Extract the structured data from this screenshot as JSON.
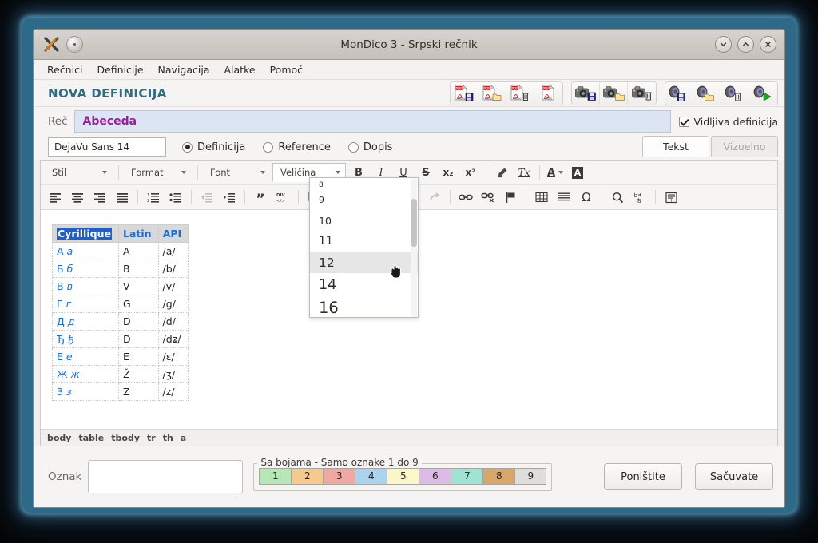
{
  "window": {
    "title": "MonDico 3 - Srpski rečnik",
    "app_icon": "scissors-x-icon",
    "menu_dot_icon": "window-menu-icon",
    "buttons": {
      "minimize": "chevron-down-icon",
      "maximize": "chevron-up-icon",
      "close": "close-icon"
    }
  },
  "menubar": {
    "items": [
      {
        "label": "Rečnici"
      },
      {
        "label": "Definicije"
      },
      {
        "label": "Navigacija"
      },
      {
        "label": "Alatke"
      },
      {
        "label": "Pomoć"
      }
    ]
  },
  "header": {
    "page_title": "NOVA DEFINICIJA",
    "icon_groups": [
      {
        "name": "pdf-group",
        "buttons": [
          {
            "icon": "pdf-save-icon",
            "badge": "floppy"
          },
          {
            "icon": "pdf-open-icon",
            "badge": "folder"
          },
          {
            "icon": "pdf-delete-icon",
            "badge": "trash"
          },
          {
            "icon": "pdf-icon",
            "badge": "none"
          }
        ]
      },
      {
        "name": "photo-group",
        "buttons": [
          {
            "icon": "camera-save-icon",
            "badge": "floppy"
          },
          {
            "icon": "camera-open-icon",
            "badge": "folder"
          },
          {
            "icon": "camera-delete-icon",
            "badge": "trash"
          }
        ]
      },
      {
        "name": "sound-group",
        "buttons": [
          {
            "icon": "sound-save-icon",
            "badge": "floppy"
          },
          {
            "icon": "sound-open-icon",
            "badge": "folder"
          },
          {
            "icon": "sound-delete-icon",
            "badge": "trash"
          },
          {
            "icon": "sound-play-icon",
            "badge": "play"
          }
        ]
      }
    ]
  },
  "word_row": {
    "label": "Reč",
    "value": "Abeceda",
    "visible_definition": {
      "label": "Vidljiva definicija",
      "checked": true
    }
  },
  "font_row": {
    "font_value": "DejaVu Sans 14",
    "radios": [
      {
        "label": "Definicija",
        "selected": true
      },
      {
        "label": "Reference",
        "selected": false
      },
      {
        "label": "Dopis",
        "selected": false
      }
    ],
    "view_tabs": [
      {
        "label": "Tekst",
        "state": "active"
      },
      {
        "label": "Vizuelno",
        "state": "disabled"
      }
    ]
  },
  "editor": {
    "toolbar_row1": {
      "combos": [
        {
          "label": "Stil",
          "open": false
        },
        {
          "label": "Format",
          "open": false
        },
        {
          "label": "Font",
          "open": false
        },
        {
          "label": "Veličina",
          "open": true
        }
      ],
      "buttons": [
        {
          "icon": "bold-icon",
          "glyph": "B",
          "disabled": false
        },
        {
          "icon": "italic-icon",
          "glyph": "I",
          "disabled": false
        },
        {
          "icon": "underline-icon",
          "glyph": "U",
          "disabled": false
        },
        {
          "icon": "strikethrough-icon",
          "glyph": "S",
          "disabled": false
        },
        {
          "icon": "subscript-icon",
          "glyph": "x₂",
          "disabled": false
        },
        {
          "icon": "superscript-icon",
          "glyph": "x²",
          "disabled": false
        },
        {
          "icon": "remove-format-brush-icon",
          "glyph": "",
          "disabled": false
        },
        {
          "icon": "clear-formatting-icon",
          "glyph": "Tx",
          "disabled": false
        },
        {
          "icon": "text-color-icon",
          "glyph": "A",
          "disabled": false
        },
        {
          "icon": "background-color-icon",
          "glyph": "A",
          "disabled": false
        }
      ]
    },
    "toolbar_row2": {
      "buttons": [
        {
          "icon": "align-left-icon",
          "disabled": false
        },
        {
          "icon": "align-center-icon",
          "disabled": false
        },
        {
          "icon": "align-right-icon",
          "disabled": false
        },
        {
          "icon": "align-justify-icon",
          "disabled": false
        },
        {
          "icon": "ordered-list-icon",
          "disabled": false
        },
        {
          "icon": "unordered-list-icon",
          "disabled": false
        },
        {
          "icon": "outdent-icon",
          "disabled": true
        },
        {
          "icon": "indent-icon",
          "disabled": false
        },
        {
          "icon": "blockquote-icon",
          "disabled": false
        },
        {
          "icon": "div-container-icon",
          "disabled": false
        },
        {
          "icon": "copy-icon",
          "disabled": false
        },
        {
          "icon": "paste-icon",
          "disabled": false
        },
        {
          "icon": "paste-text-icon",
          "disabled": false
        },
        {
          "icon": "paste-word-icon",
          "disabled": false
        },
        {
          "icon": "undo-icon",
          "disabled": true
        },
        {
          "icon": "redo-icon",
          "disabled": true
        },
        {
          "icon": "link-icon",
          "disabled": false
        },
        {
          "icon": "unlink-icon",
          "disabled": false
        },
        {
          "icon": "anchor-flag-icon",
          "disabled": false
        },
        {
          "icon": "table-icon",
          "disabled": false
        },
        {
          "icon": "horizontal-rule-icon",
          "disabled": false
        },
        {
          "icon": "special-character-omega-icon",
          "disabled": false
        },
        {
          "icon": "search-icon",
          "disabled": false
        },
        {
          "icon": "replace-icon",
          "disabled": false
        },
        {
          "icon": "show-blocks-icon",
          "disabled": false
        }
      ]
    },
    "size_dropdown": {
      "name": "font-size-dropdown",
      "items": [
        {
          "label": "8",
          "highlighted": false,
          "clipped": true
        },
        {
          "label": "9",
          "highlighted": false
        },
        {
          "label": "10",
          "highlighted": false
        },
        {
          "label": "11",
          "highlighted": false
        },
        {
          "label": "12",
          "highlighted": true
        },
        {
          "label": "14",
          "highlighted": false
        },
        {
          "label": "16",
          "highlighted": false
        }
      ]
    },
    "table": {
      "headers": [
        "Cyrillique",
        "Latin",
        "API"
      ],
      "selected_header": "Cyrillique",
      "rows": [
        {
          "cyr_upper": "А",
          "cyr_lower": "а",
          "latin": "A",
          "api": "/a/"
        },
        {
          "cyr_upper": "Б",
          "cyr_lower": "б",
          "latin": "B",
          "api": "/b/"
        },
        {
          "cyr_upper": "В",
          "cyr_lower": "в",
          "latin": "V",
          "api": "/v/"
        },
        {
          "cyr_upper": "Г",
          "cyr_lower": "г",
          "latin": "G",
          "api": "/g/"
        },
        {
          "cyr_upper": "Д",
          "cyr_lower": "д",
          "latin": "D",
          "api": "/d/"
        },
        {
          "cyr_upper": "Ђ",
          "cyr_lower": "ђ",
          "latin": "Đ",
          "api": "/dʑ/"
        },
        {
          "cyr_upper": "Е",
          "cyr_lower": "е",
          "latin": "E",
          "api": "/ɛ/"
        },
        {
          "cyr_upper": "Ж",
          "cyr_lower": "ж",
          "latin": "Ž",
          "api": "/ʒ/"
        },
        {
          "cyr_upper": "З",
          "cyr_lower": "з",
          "latin": "Z",
          "api": "/z/"
        }
      ]
    },
    "path": [
      "body",
      "table",
      "tbody",
      "tr",
      "th",
      "a"
    ]
  },
  "bottom": {
    "tag_label": "Oznak",
    "tag_value": "",
    "colors_legend": "Sa bojama - Samo oznake 1 do 9",
    "color_tags": [
      {
        "label": "1",
        "color": "#b5e8b5"
      },
      {
        "label": "2",
        "color": "#f5ca8e"
      },
      {
        "label": "3",
        "color": "#f0a8a2"
      },
      {
        "label": "4",
        "color": "#abd3ef"
      },
      {
        "label": "5",
        "color": "#faf8c8"
      },
      {
        "label": "6",
        "color": "#dcbce6"
      },
      {
        "label": "7",
        "color": "#9fe3d5"
      },
      {
        "label": "8",
        "color": "#d8a86a"
      },
      {
        "label": "9",
        "color": "#dededd"
      }
    ],
    "buttons": [
      {
        "label": "Poništite",
        "name": "cancel-button"
      },
      {
        "label": "Sačuvate",
        "name": "save-button"
      }
    ]
  }
}
